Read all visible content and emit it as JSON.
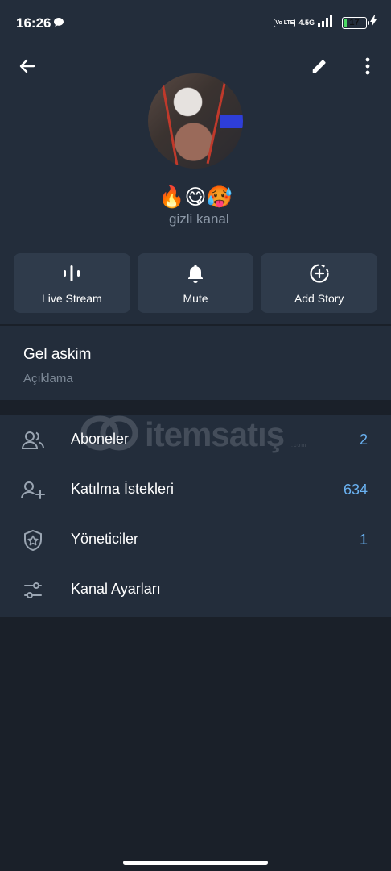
{
  "status_bar": {
    "time": "16:26",
    "volte": "Vo LTE",
    "network": "4.5G",
    "battery": "17",
    "battery_level": 0.17
  },
  "header": {
    "back_icon": "arrow-left-icon",
    "edit_icon": "pencil-icon",
    "more_icon": "more-vertical-icon"
  },
  "channel": {
    "title": "🔥😋🥵",
    "subtitle": "gizli kanal"
  },
  "actions": [
    {
      "label": "Live Stream",
      "icon": "live-stream-icon"
    },
    {
      "label": "Mute",
      "icon": "bell-icon"
    },
    {
      "label": "Add Story",
      "icon": "add-story-icon"
    }
  ],
  "about": {
    "title": "Gel askim",
    "description": "Açıklama"
  },
  "list": [
    {
      "label": "Aboneler",
      "count": "2",
      "icon": "users-icon"
    },
    {
      "label": "Katılma İstekleri",
      "count": "634",
      "icon": "user-add-icon"
    },
    {
      "label": "Yöneticiler",
      "count": "1",
      "icon": "shield-star-icon"
    },
    {
      "label": "Kanal Ayarları",
      "count": "",
      "icon": "sliders-icon"
    }
  ],
  "watermark": {
    "text": "itemsatış",
    "sub": ".com"
  },
  "colors": {
    "background": "#1a2029",
    "panel": "#232d3b",
    "button": "#2f3b4b",
    "accent": "#6ab2f2",
    "muted": "#8d99a8"
  }
}
